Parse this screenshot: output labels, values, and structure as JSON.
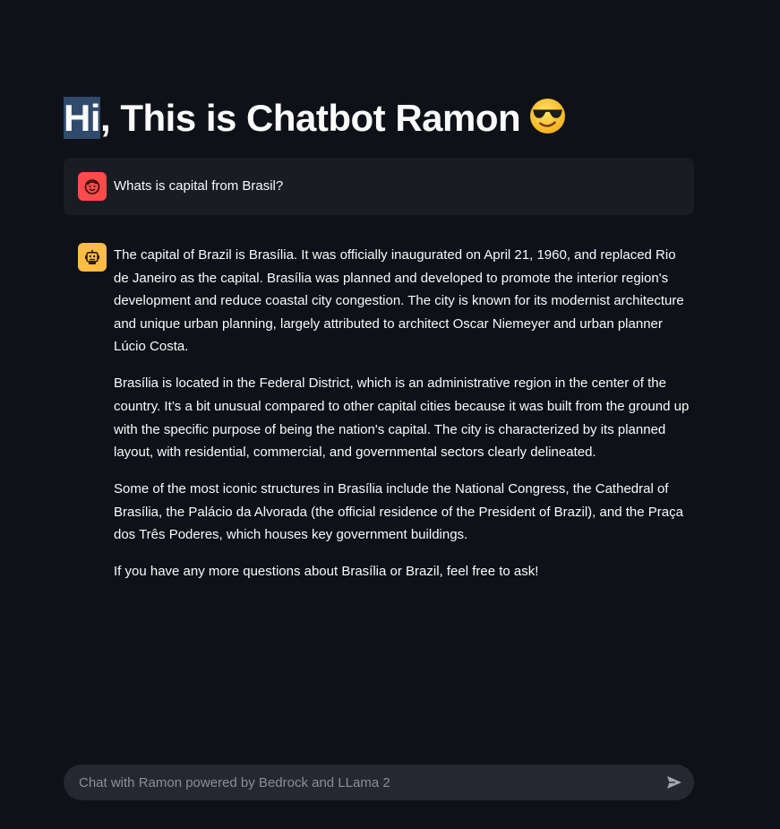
{
  "header": {
    "title_highlight": "Hi",
    "title_rest": ", This is Chatbot Ramon",
    "title_emoji": "sunglasses-emoji"
  },
  "messages": [
    {
      "role": "user",
      "avatar_icon": "user-face-icon",
      "avatar_color": "#ff4b4b",
      "text": "Whats is capital from Brasil?"
    },
    {
      "role": "assistant",
      "avatar_icon": "robot-icon",
      "avatar_color": "#ffbd45",
      "paragraphs": [
        "The capital of Brazil is Brasília. It was officially inaugurated on April 21, 1960, and replaced Rio de Janeiro as the capital. Brasília was planned and developed to promote the interior region's development and reduce coastal city congestion. The city is known for its modernist architecture and unique urban planning, largely attributed to architect Oscar Niemeyer and urban planner Lúcio Costa.",
        "Brasília is located in the Federal District, which is an administrative region in the center of the country. It’s a bit unusual compared to other capital cities because it was built from the ground up with the specific purpose of being the nation's capital. The city is characterized by its planned layout, with residential, commercial, and governmental sectors clearly delineated.",
        "Some of the most iconic structures in Brasília include the National Congress, the Cathedral of Brasília, the Palácio da Alvorada (the official residence of the President of Brazil), and the Praça dos Três Poderes, which houses key government buildings.",
        "If you have any more questions about Brasília or Brazil, feel free to ask!"
      ]
    }
  ],
  "chat_input": {
    "placeholder": "Chat with Ramon powered by Bedrock and LLama 2",
    "value": "",
    "send_icon": "send-icon"
  },
  "colors": {
    "background": "#0e1117",
    "user_bubble": "#1a1c24",
    "input_background": "#262730",
    "title_highlight": "#2f4a6b"
  }
}
